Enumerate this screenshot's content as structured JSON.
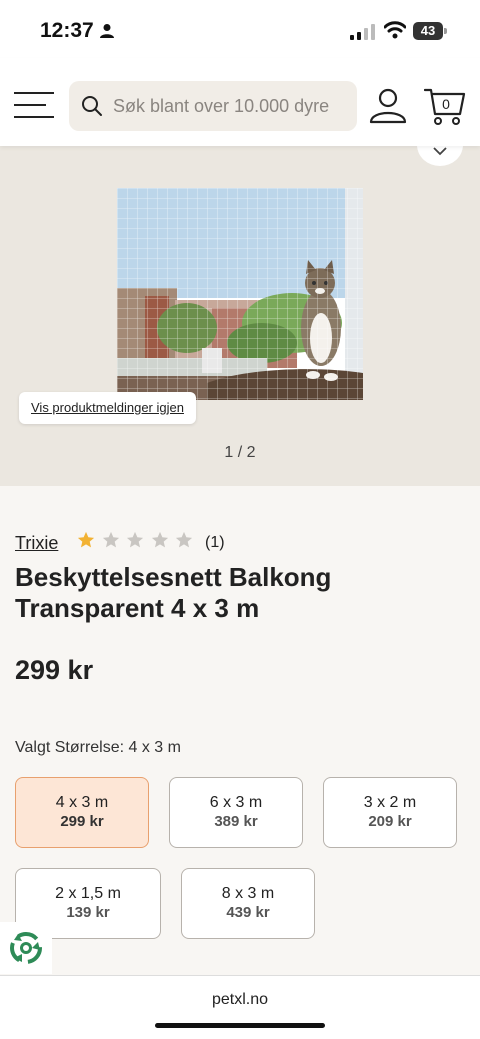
{
  "status_bar": {
    "time": "12:37",
    "battery": "43"
  },
  "header": {
    "search_placeholder": "Søk blant over 10.000 dyre",
    "cart_count": "0"
  },
  "gallery": {
    "notice_label": "Vis produktmeldinger igjen",
    "pager": "1 / 2"
  },
  "product": {
    "brand": "Trixie",
    "rating": 1,
    "rating_max": 5,
    "review_count": "(1)",
    "title": "Beskyttelsesnett Balkong Transparent 4 x 3 m",
    "price": "299 kr",
    "selected_size_label": "Valgt Størrelse: 4 x 3 m"
  },
  "sizes": [
    {
      "name": "4 x 3 m",
      "price": "299 kr",
      "selected": true
    },
    {
      "name": "6 x 3 m",
      "price": "389 kr",
      "selected": false
    },
    {
      "name": "3 x 2 m",
      "price": "209 kr",
      "selected": false
    },
    {
      "name": "2 x 1,5 m",
      "price": "139 kr",
      "selected": false
    },
    {
      "name": "8 x 3 m",
      "price": "439 kr",
      "selected": false
    }
  ],
  "browser": {
    "url": "petxl.no"
  },
  "colors": {
    "star_filled": "#f2b233",
    "star_empty": "#c9c6c2",
    "selected_bg": "#fde6d6",
    "selected_border": "#e8a06e"
  },
  "icons": [
    "person-icon",
    "signal-icon",
    "wifi-icon",
    "menu-icon",
    "search-icon",
    "account-icon",
    "cart-icon",
    "chevron-down-icon",
    "star-icon",
    "recycle-icon"
  ]
}
